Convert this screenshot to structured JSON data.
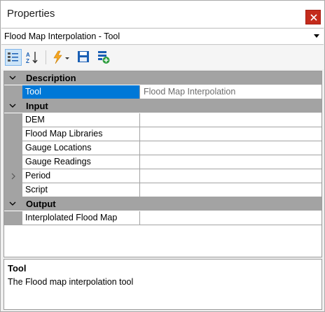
{
  "window": {
    "title": "Properties"
  },
  "selector": {
    "value": "Flood Map Interpolation - Tool"
  },
  "toolbar": {
    "icons": [
      "categorized-icon",
      "alphabetical-icon",
      "events-icon",
      "save-icon",
      "add-icon"
    ]
  },
  "grid": {
    "categories": [
      {
        "label": "Description",
        "rows": [
          {
            "name": "Tool",
            "value": "Flood Map Interpolation"
          }
        ]
      },
      {
        "label": "Input",
        "rows": [
          {
            "name": "DEM",
            "value": ""
          },
          {
            "name": "Flood Map Libraries",
            "value": ""
          },
          {
            "name": "Gauge Locations",
            "value": ""
          },
          {
            "name": "Gauge Readings",
            "value": ""
          },
          {
            "name": "Period",
            "value": ""
          },
          {
            "name": "Script",
            "value": ""
          }
        ]
      },
      {
        "label": "Output",
        "rows": [
          {
            "name": "Interplolated Flood Map",
            "value": ""
          }
        ]
      }
    ]
  },
  "description": {
    "title": "Tool",
    "text": "The Flood map interpolation tool"
  },
  "colors": {
    "selection": "#0078d7",
    "category_bg": "#a3a3a3",
    "close_button": "#c42b1c"
  }
}
